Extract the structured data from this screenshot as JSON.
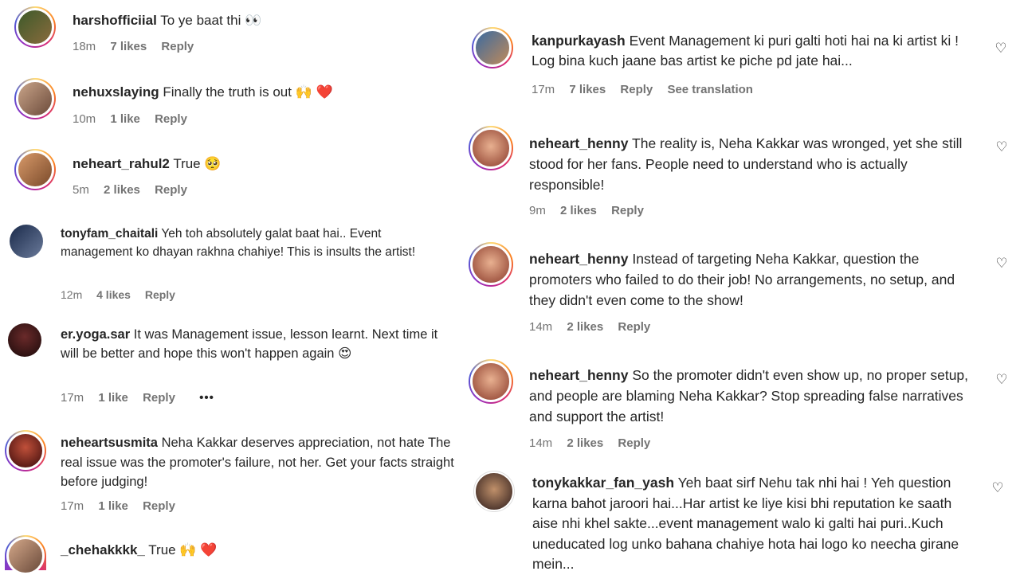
{
  "left": [
    {
      "user": "harshofficiial",
      "text": "To ye baat thi 👀",
      "time": "18m",
      "likes": "7 likes",
      "reply": "Reply"
    },
    {
      "user": "nehuxslaying",
      "text": "Finally the truth is out 🙌 ❤️",
      "time": "10m",
      "likes": "1 like",
      "reply": "Reply"
    },
    {
      "user": "neheart_rahul2",
      "text": "True 🥺",
      "time": "5m",
      "likes": "2 likes",
      "reply": "Reply"
    },
    {
      "user": "tonyfam_chaitali",
      "text": "Yeh toh absolutely galat baat hai.. Event management ko dhayan rakhna chahiye! This is insults the artist!",
      "time": "12m",
      "likes": "4 likes",
      "reply": "Reply"
    },
    {
      "user": "er.yoga.sar",
      "text": "It was Management issue, lesson learnt. Next time it will be better and hope this won't happen again 😍",
      "time": "17m",
      "likes": "1 like",
      "reply": "Reply",
      "more": "•••"
    },
    {
      "user": "neheartsusmita",
      "text": "Neha Kakkar deserves appreciation, not hate The real issue was the promoter's failure, not her. Get your facts straight before judging!",
      "time": "17m",
      "likes": "1 like",
      "reply": "Reply"
    },
    {
      "user": "_chehakkkk_",
      "text": "True 🙌 ❤️"
    }
  ],
  "right": [
    {
      "user": "kanpurkayash",
      "text": "Event Management ki puri galti hoti hai na ki artist ki ! Log bina kuch jaane bas artist ke piche pd jate hai...",
      "time": "17m",
      "likes": "7 likes",
      "reply": "Reply",
      "translate": "See translation"
    },
    {
      "user": "neheart_henny",
      "text": "The reality is, Neha Kakkar was wronged, yet she still stood for her fans. People need to understand who is actually responsible!",
      "time": "9m",
      "likes": "2 likes",
      "reply": "Reply"
    },
    {
      "user": "neheart_henny",
      "text": "Instead of targeting Neha Kakkar, question the promoters who failed to do their job! No arrangements, no setup, and they didn't even come to the show!",
      "time": "14m",
      "likes": "2 likes",
      "reply": "Reply"
    },
    {
      "user": "neheart_henny",
      "text": "So the promoter didn't even show up, no proper setup, and people are blaming Neha Kakkar? Stop spreading false narratives and support the artist!",
      "time": "14m",
      "likes": "2 likes",
      "reply": "Reply"
    },
    {
      "user": "tonykakkar_fan_yash",
      "text": "Yeh baat sirf Nehu tak nhi hai ! Yeh question karna bahot jaroori hai...Har artist ke liye kisi bhi reputation ke saath aise nhi khel sakte...event management walo ki galti hai puri..Kuch uneducated log unko bahana chahiye hota hai logo ko neecha girane mein..."
    }
  ],
  "icons": {
    "like": "heart-outline-icon",
    "more": "more-dots-icon"
  }
}
